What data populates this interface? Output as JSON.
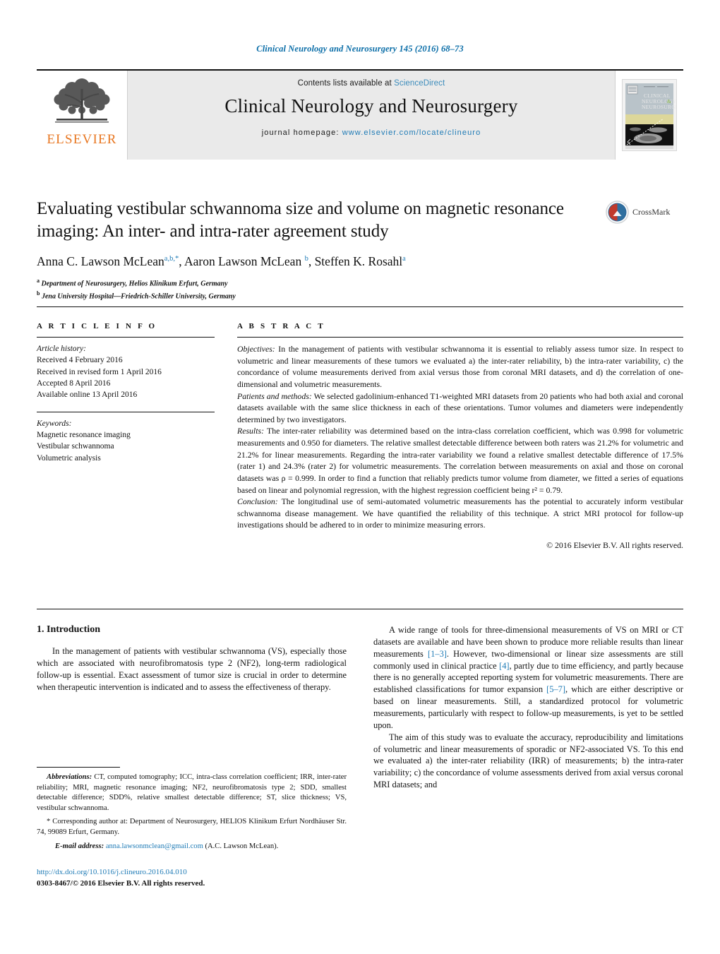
{
  "running_head": "Clinical Neurology and Neurosurgery 145 (2016) 68–73",
  "masthead": {
    "publisher_name": "ELSEVIER",
    "contents_prefix": "Contents lists available at ",
    "contents_link": "ScienceDirect",
    "journal_title": "Clinical Neurology and Neurosurgery",
    "homepage_prefix": "journal homepage: ",
    "homepage_url": "www.elsevier.com/locate/clineuro",
    "cover_title_line1": "CLINICAL",
    "cover_title_line2": "NEUROLOGY &",
    "cover_title_line3": "NEUROSURGERY"
  },
  "article": {
    "title": "Evaluating vestibular schwannoma size and volume on magnetic resonance imaging: An inter- and intra-rater agreement study",
    "authors_html": "Anna C. Lawson McLean<sup>a,b,*</sup>, Aaron Lawson McLean <sup>b</sup>, Steffen K. Rosahl<sup>a</sup>",
    "affiliation_a": "Department of Neurosurgery, Helios Klinikum Erfurt, Germany",
    "affiliation_b": "Jena University Hospital—Friedrich-Schiller University, Germany",
    "crossmark_label": "CrossMark"
  },
  "article_info": {
    "heading": "A R T I C L E   I N F O",
    "history_label": "Article history:",
    "history": [
      "Received 4 February 2016",
      "Received in revised form 1 April 2016",
      "Accepted 8 April 2016",
      "Available online 13 April 2016"
    ],
    "keywords_label": "Keywords:",
    "keywords": [
      "Magnetic resonance imaging",
      "Vestibular schwannoma",
      "Volumetric analysis"
    ]
  },
  "abstract": {
    "heading": "A B S T R A C T",
    "objectives_label": "Objectives:",
    "objectives_text": " In the management of patients with vestibular schwannoma it is essential to reliably assess tumor size. In respect to volumetric and linear measurements of these tumors we evaluated a) the inter-rater reliability, b) the intra-rater variability, c) the concordance of volume measurements derived from axial versus those from coronal MRI datasets, and d) the correlation of one-dimensional and volumetric measurements.",
    "methods_label": "Patients and methods:",
    "methods_text": " We selected gadolinium-enhanced T1-weighted MRI datasets from 20 patients who had both axial and coronal datasets available with the same slice thickness in each of these orientations. Tumor volumes and diameters were independently determined by two investigators.",
    "results_label": "Results:",
    "results_text": " The inter-rater reliability was determined based on the intra-class correlation coefficient, which was 0.998 for volumetric measurements and 0.950 for diameters. The relative smallest detectable difference between both raters was 21.2% for volumetric and 21.2% for linear measurements. Regarding the intra-rater variability we found a relative smallest detectable difference of 17.5% (rater 1) and 24.3% (rater 2) for volumetric measurements. The correlation between measurements on axial and those on coronal datasets was ρ = 0.999. In order to find a function that reliably predicts tumor volume from diameter, we fitted a series of equations based on linear and polynomial regression, with the highest regression coefficient being r² = 0.79.",
    "conclusion_label": "Conclusion:",
    "conclusion_text": " The longitudinal use of semi-automated volumetric measurements has the potential to accurately inform vestibular schwannoma disease management. We have quantified the reliability of this technique. A strict MRI protocol for follow-up investigations should be adhered to in order to minimize measuring errors.",
    "copyright": "© 2016 Elsevier B.V. All rights reserved."
  },
  "introduction": {
    "heading": "1.  Introduction",
    "para1": "In the management of patients with vestibular schwannoma (VS), especially those which are associated with neurofibromatosis type 2 (NF2), long-term radiological follow-up is essential. Exact assessment of tumor size is crucial in order to determine when therapeutic intervention is indicated and to assess the effectiveness of therapy.",
    "para2_part1": "A wide range of tools for three-dimensional measurements of VS on MRI or CT datasets are available and have been shown to produce more reliable results than linear measurements ",
    "para2_ref1": "[1–3]",
    "para2_part2": ". However, two-dimensional or linear size assessments are still commonly used in clinical practice ",
    "para2_ref2": "[4]",
    "para2_part3": ", partly due to time efficiency, and partly because there is no generally accepted reporting system for volumetric measurements. There are established classifications for tumor expansion ",
    "para2_ref3": "[5–7]",
    "para2_part4": ", which are either descriptive or based on linear measurements. Still, a standardized protocol for volumetric measurements, particularly with respect to follow-up measurements, is yet to be settled upon.",
    "para3": "The aim of this study was to evaluate the accuracy, reproducibility and limitations of volumetric and linear measurements of sporadic or NF2-associated VS. To this end we evaluated a) the inter-rater reliability (IRR) of measurements; b) the intra-rater variability; c) the concordance of volume assessments derived from axial versus coronal MRI datasets; and"
  },
  "footnotes": {
    "abbrev_label": "Abbreviations:",
    "abbrev_text": " CT, computed tomography; ICC, intra-class correlation coefficient; IRR, inter-rater reliability; MRI, magnetic resonance imaging; NF2, neurofibromatosis type 2; SDD, smallest detectable difference; SDD%, relative smallest detectable difference; ST, slice thickness; VS, vestibular schwannoma.",
    "corresponding": "* Corresponding author at: Department of Neurosurgery, HELIOS Klinikum Erfurt Nordhäuser Str. 74, 99089 Erfurt, Germany.",
    "email_label": "E-mail address:",
    "email": "anna.lawsonmclean@gmail.com",
    "email_suffix": " (A.C. Lawson McLean).",
    "doi": "http://dx.doi.org/10.1016/j.clineuro.2016.04.010",
    "issn": "0303-8467/© 2016 Elsevier B.V. All rights reserved."
  },
  "colors": {
    "link": "#1f7bb6",
    "header_blue": "#0b6ea8",
    "elsevier_orange": "#E87722",
    "mast_bg": "#eaeaea"
  }
}
